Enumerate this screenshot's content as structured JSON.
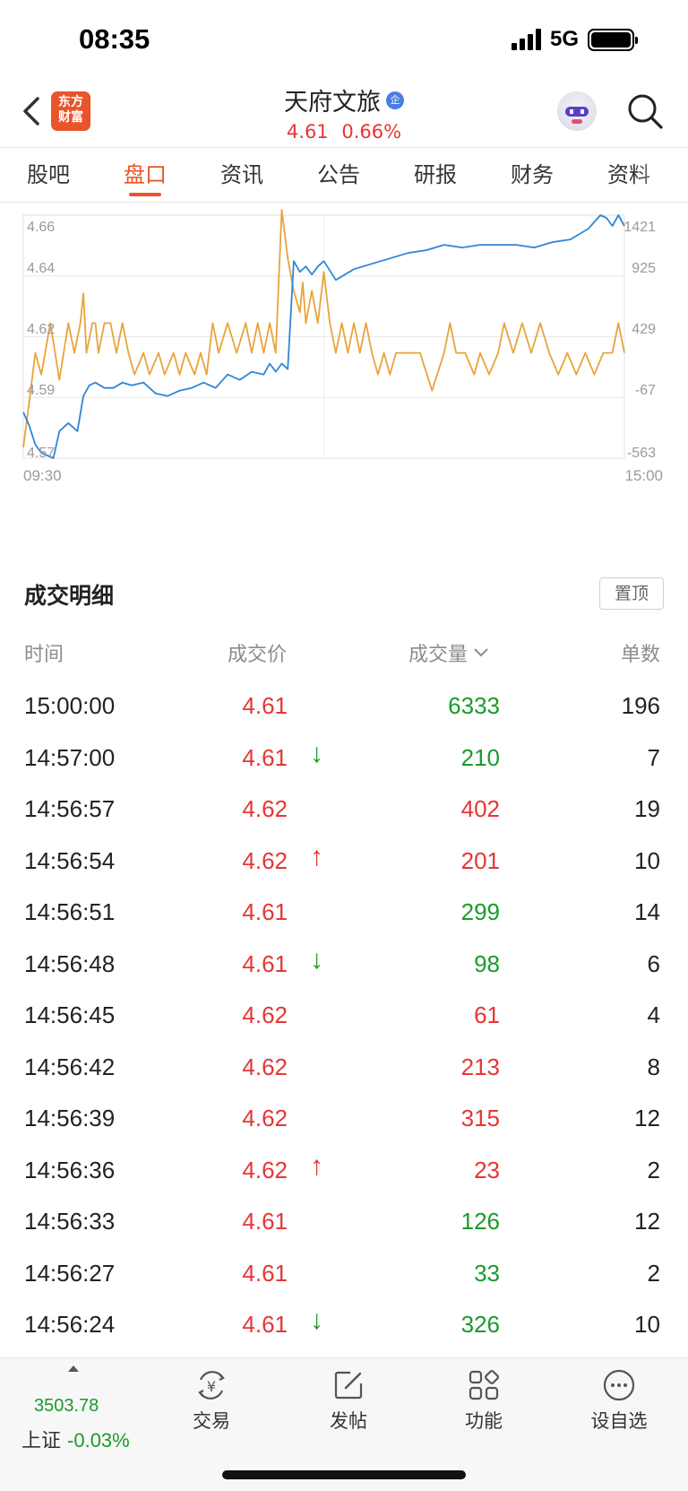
{
  "status_bar": {
    "time": "08:35",
    "network": "5G"
  },
  "header": {
    "logo_line1": "东方",
    "logo_line2": "财富",
    "stock_name": "天府文旅",
    "badge": "企",
    "price": "4.61",
    "change_pct": "0.66%"
  },
  "tabs": [
    {
      "label": "股吧"
    },
    {
      "label": "盘口",
      "active": true
    },
    {
      "label": "资讯"
    },
    {
      "label": "公告"
    },
    {
      "label": "研报"
    },
    {
      "label": "财务"
    },
    {
      "label": "资料"
    }
  ],
  "chart_data": {
    "type": "line",
    "title": "",
    "x_start_label": "09:30",
    "x_end_label": "15:00",
    "x_range": [
      "09:30",
      "15:00"
    ],
    "left_axis": {
      "ticks": [
        "4.66",
        "4.64",
        "4.62",
        "4.59",
        "4.57"
      ],
      "ylim": [
        4.57,
        4.66
      ]
    },
    "right_axis": {
      "ticks": [
        "1421",
        "925",
        "429",
        "-67",
        "-563"
      ],
      "ylim": [
        -563,
        1421
      ]
    },
    "grid": true,
    "series": [
      {
        "axis": "left",
        "color": "#e8a43a",
        "x": [
          0,
          0.01,
          0.02,
          0.03,
          0.045,
          0.06,
          0.075,
          0.085,
          0.095,
          0.1,
          0.105,
          0.115,
          0.12,
          0.125,
          0.135,
          0.145,
          0.155,
          0.165,
          0.175,
          0.185,
          0.2,
          0.21,
          0.225,
          0.235,
          0.25,
          0.26,
          0.27,
          0.285,
          0.295,
          0.305,
          0.315,
          0.325,
          0.34,
          0.355,
          0.37,
          0.38,
          0.39,
          0.4,
          0.41,
          0.42,
          0.43,
          0.44,
          0.45,
          0.46,
          0.465,
          0.47,
          0.48,
          0.49,
          0.5,
          0.51,
          0.52,
          0.53,
          0.54,
          0.55,
          0.56,
          0.57,
          0.58,
          0.59,
          0.6,
          0.61,
          0.62,
          0.64,
          0.66,
          0.68,
          0.7,
          0.71,
          0.72,
          0.735,
          0.75,
          0.76,
          0.775,
          0.79,
          0.8,
          0.815,
          0.83,
          0.845,
          0.86,
          0.875,
          0.89,
          0.905,
          0.92,
          0.935,
          0.95,
          0.965,
          0.98,
          0.99,
          1
        ],
        "y": [
          4.574,
          4.591,
          4.609,
          4.601,
          4.62,
          4.599,
          4.62,
          4.609,
          4.62,
          4.631,
          4.609,
          4.62,
          4.62,
          4.609,
          4.62,
          4.62,
          4.609,
          4.62,
          4.609,
          4.601,
          4.609,
          4.601,
          4.609,
          4.601,
          4.609,
          4.601,
          4.609,
          4.601,
          4.609,
          4.601,
          4.62,
          4.609,
          4.62,
          4.609,
          4.62,
          4.609,
          4.62,
          4.609,
          4.62,
          4.609,
          4.662,
          4.644,
          4.632,
          4.624,
          4.635,
          4.62,
          4.632,
          4.62,
          4.639,
          4.62,
          4.609,
          4.62,
          4.609,
          4.62,
          4.609,
          4.62,
          4.609,
          4.601,
          4.609,
          4.601,
          4.609,
          4.609,
          4.609,
          4.595,
          4.609,
          4.62,
          4.609,
          4.609,
          4.601,
          4.609,
          4.601,
          4.609,
          4.62,
          4.609,
          4.62,
          4.609,
          4.62,
          4.609,
          4.601,
          4.609,
          4.601,
          4.609,
          4.601,
          4.609,
          4.609,
          4.62,
          4.609
        ]
      },
      {
        "axis": "left",
        "color": "#2e86d8",
        "x": [
          0,
          0.01,
          0.02,
          0.03,
          0.04,
          0.05,
          0.06,
          0.075,
          0.09,
          0.1,
          0.11,
          0.12,
          0.135,
          0.15,
          0.165,
          0.18,
          0.2,
          0.22,
          0.24,
          0.26,
          0.28,
          0.3,
          0.32,
          0.34,
          0.36,
          0.38,
          0.4,
          0.41,
          0.42,
          0.43,
          0.44,
          0.45,
          0.46,
          0.47,
          0.48,
          0.49,
          0.5,
          0.52,
          0.55,
          0.58,
          0.61,
          0.64,
          0.67,
          0.7,
          0.73,
          0.76,
          0.79,
          0.82,
          0.85,
          0.88,
          0.91,
          0.94,
          0.96,
          0.97,
          0.98,
          0.99,
          1
        ],
        "y": [
          4.587,
          4.582,
          4.575,
          4.572,
          4.571,
          4.57,
          4.58,
          4.583,
          4.58,
          4.593,
          4.597,
          4.598,
          4.596,
          4.596,
          4.598,
          4.597,
          4.598,
          4.594,
          4.593,
          4.595,
          4.596,
          4.598,
          4.596,
          4.601,
          4.599,
          4.602,
          4.601,
          4.605,
          4.602,
          4.605,
          4.603,
          4.643,
          4.639,
          4.641,
          4.638,
          4.641,
          4.643,
          4.636,
          4.64,
          4.642,
          4.644,
          4.646,
          4.647,
          4.649,
          4.648,
          4.649,
          4.649,
          4.649,
          4.648,
          4.65,
          4.651,
          4.655,
          4.66,
          4.659,
          4.656,
          4.66,
          4.656
        ]
      }
    ]
  },
  "details": {
    "title": "成交明细",
    "pin_label": "置顶",
    "columns": {
      "time": "时间",
      "price": "成交价",
      "volume": "成交量",
      "count": "单数"
    },
    "rows": [
      {
        "time": "15:00:00",
        "price": "4.61",
        "arrow": "",
        "volume": "6333",
        "count": "196",
        "price_color": "red",
        "volume_color": "green"
      },
      {
        "time": "14:57:00",
        "price": "4.61",
        "arrow": "↓",
        "volume": "210",
        "count": "7",
        "price_color": "red",
        "volume_color": "green"
      },
      {
        "time": "14:56:57",
        "price": "4.62",
        "arrow": "",
        "volume": "402",
        "count": "19",
        "price_color": "red",
        "volume_color": "red"
      },
      {
        "time": "14:56:54",
        "price": "4.62",
        "arrow": "↑",
        "volume": "201",
        "count": "10",
        "price_color": "red",
        "volume_color": "red"
      },
      {
        "time": "14:56:51",
        "price": "4.61",
        "arrow": "",
        "volume": "299",
        "count": "14",
        "price_color": "red",
        "volume_color": "green"
      },
      {
        "time": "14:56:48",
        "price": "4.61",
        "arrow": "↓",
        "volume": "98",
        "count": "6",
        "price_color": "red",
        "volume_color": "green"
      },
      {
        "time": "14:56:45",
        "price": "4.62",
        "arrow": "",
        "volume": "61",
        "count": "4",
        "price_color": "red",
        "volume_color": "red"
      },
      {
        "time": "14:56:42",
        "price": "4.62",
        "arrow": "",
        "volume": "213",
        "count": "8",
        "price_color": "red",
        "volume_color": "red"
      },
      {
        "time": "14:56:39",
        "price": "4.62",
        "arrow": "",
        "volume": "315",
        "count": "12",
        "price_color": "red",
        "volume_color": "red"
      },
      {
        "time": "14:56:36",
        "price": "4.62",
        "arrow": "↑",
        "volume": "23",
        "count": "2",
        "price_color": "red",
        "volume_color": "red"
      },
      {
        "time": "14:56:33",
        "price": "4.61",
        "arrow": "",
        "volume": "126",
        "count": "12",
        "price_color": "red",
        "volume_color": "green"
      },
      {
        "time": "14:56:27",
        "price": "4.61",
        "arrow": "",
        "volume": "33",
        "count": "2",
        "price_color": "red",
        "volume_color": "green"
      },
      {
        "time": "14:56:24",
        "price": "4.61",
        "arrow": "↓",
        "volume": "326",
        "count": "10",
        "price_color": "red",
        "volume_color": "green"
      }
    ]
  },
  "bottom_bar": {
    "index_value": "3503.78",
    "index_name": "上证",
    "index_change": "-0.03%",
    "nav": [
      {
        "label": "交易",
        "icon": "trade-yen-icon"
      },
      {
        "label": "发帖",
        "icon": "compose-icon"
      },
      {
        "label": "功能",
        "icon": "apps-grid-icon"
      },
      {
        "label": "设自选",
        "icon": "more-circle-icon"
      }
    ]
  },
  "colors": {
    "up": "#e73535",
    "down": "#1a9a2c",
    "accent": "#e8552a",
    "price_line": "#2e86d8",
    "avg_line": "#e8a43a"
  }
}
